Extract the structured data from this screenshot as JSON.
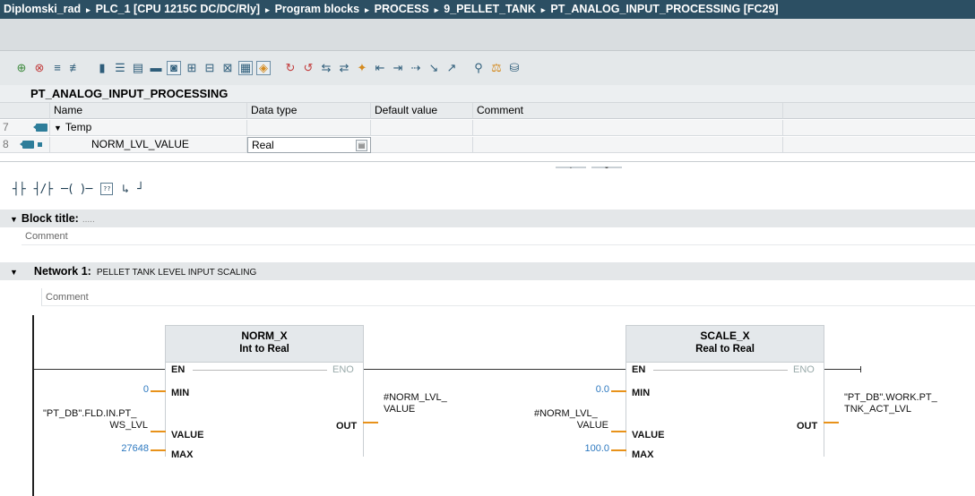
{
  "breadcrumb": {
    "items": [
      "Diplomski_rad",
      "PLC_1 [CPU 1215C DC/DC/Rly]",
      "Program blocks",
      "PROCESS",
      "9_PELLET_TANK",
      "PT_ANALOG_INPUT_PROCESSING [FC29]"
    ],
    "separator": "▸"
  },
  "toolbar": {
    "icons": [
      "insert-row-icon",
      "delete-row-icon",
      "insert-network-icon",
      "delete-network-icon",
      "absolute-operand-icon",
      "network-collapse-icon",
      "network-expand-icon",
      "comment-toggle-icon",
      "comments-visible-icon",
      "favorites-icon",
      "program-status-icon",
      "monitor-icon",
      "watch-icon",
      "symbol-info-icon",
      "tag-info-icon",
      "goto-previous-error-icon",
      "goto-next-error-icon",
      "compare-icon",
      "settings-icon",
      "download-icon"
    ]
  },
  "interface": {
    "block_name": "PT_ANALOG_INPUT_PROCESSING",
    "columns": [
      "Name",
      "Data type",
      "Default value",
      "Comment"
    ],
    "rows": [
      {
        "num": "7",
        "name": "Temp",
        "type": "",
        "default": "",
        "comment": ""
      },
      {
        "num": "8",
        "name": "NORM_LVL_VALUE",
        "type": "Real",
        "default": "",
        "comment": ""
      }
    ]
  },
  "ladder_tools": [
    "normally-open-contact",
    "normally-closed-contact",
    "coil",
    "empty-box",
    "open-branch",
    "close-branch"
  ],
  "block_title": {
    "label": "Block title:",
    "placeholder": ".....",
    "comment": "Comment"
  },
  "network": {
    "label": "Network 1:",
    "description": "PELLET TANK LEVEL INPUT SCALING",
    "comment": "Comment",
    "norm_x": {
      "name": "NORM_X",
      "types": [
        "Int",
        "to",
        "Real"
      ],
      "pins_in": [
        "EN",
        "MIN",
        "VALUE",
        "MAX"
      ],
      "pin_out_eno": "ENO",
      "pin_out": "OUT",
      "min_operand": "0",
      "value_operand": [
        "\"PT_DB\".FLD.IN.PT_",
        "WS_LVL"
      ],
      "max_operand": "27648",
      "out_operand": [
        "#NORM_LVL_",
        "VALUE"
      ]
    },
    "scale_x": {
      "name": "SCALE_X",
      "types": [
        "Real",
        "to",
        "Real"
      ],
      "pins_in": [
        "EN",
        "MIN",
        "VALUE",
        "MAX"
      ],
      "pin_out_eno": "ENO",
      "pin_out": "OUT",
      "min_operand": "0.0",
      "value_operand": [
        "#NORM_LVL_",
        "VALUE"
      ],
      "max_operand": "100.0",
      "out_operand": [
        "\"PT_DB\".WORK.PT_",
        "TNK_ACT_LVL"
      ]
    }
  },
  "colors": {
    "titlebar": "#2c4f63",
    "operand_wire": "#e8921a",
    "numeric_operand": "#2d79c0",
    "function_box": "#e4e8eb"
  }
}
